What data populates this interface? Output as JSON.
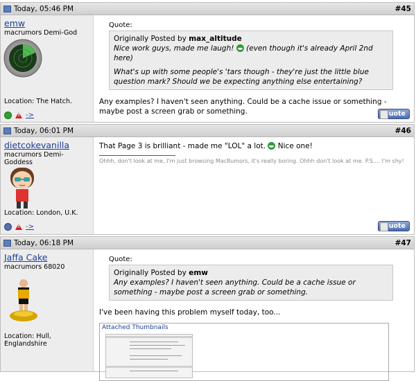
{
  "posts": [
    {
      "time": "Today, 05:46 PM",
      "number": "#45",
      "username": "emw",
      "usertitle": "macrumors Demi-God",
      "avatar": "radar-avatar",
      "location": "Location: The Hatch.",
      "status": "online",
      "arrow": "->",
      "quote_label": "Quote:",
      "quote_prefix": "Originally Posted by ",
      "quote_author": "max_altitude",
      "quote_line1": "Nice work guys, made me laugh!",
      "quote_line1b": "(even though it's already April 2nd here)",
      "quote_line2": "What's up with some people's 'tars though - they're just the little blue question mark? Should we be expecting anything else entertaining?",
      "message": "Any examples? I haven't seen anything. Could be a cache issue or something - maybe post a screen grab or something.",
      "quote_button": "Quote"
    },
    {
      "time": "Today, 06:01 PM",
      "number": "#46",
      "username": "dietcokevanilla",
      "usertitle": "macrumors Demi-Goddess",
      "avatar": "cartoon-girl-avatar",
      "location": "Location: London, U.K.",
      "status": "offline",
      "arrow": "->",
      "message_a": "That Page 3 is brilliant - made me \"LOL\" a lot.",
      "message_b": "Nice one!",
      "signature": "Ohhh, don't look at me, I'm just browsing MacRumors, it's really boring. Ohhh don't look at me. P.S.... I'm shy!",
      "quote_button": "Quote"
    },
    {
      "time": "Today, 06:18 PM",
      "number": "#47",
      "username": "Jaffa Cake",
      "usertitle": "macrumors 68020",
      "avatar": "football-figure-avatar",
      "location": "Location: Hull, Englandshire",
      "quote_label": "Quote:",
      "quote_prefix": "Originally Posted by ",
      "quote_author": "emw",
      "quote_text": "Any examples? I haven't seen anything. Could be a cache issue or something - maybe post a screen grab or something.",
      "message": "I've been having this problem myself today, too...",
      "attachments_title": "Attached Thumbnails"
    }
  ],
  "colors": {
    "link": "#1b3d9a",
    "header_bg": "#d9d9d9",
    "sidebar_bg": "#ededed"
  }
}
